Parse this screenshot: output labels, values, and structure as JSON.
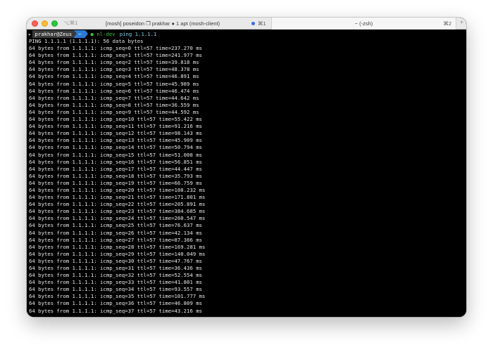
{
  "titlebar": {
    "shortcut": "⌥⌘1",
    "tabs": [
      {
        "title": "[mosh] poseidon ❐ prakhar ● 1 apt (mosh-client)",
        "shortcut": "⌘1"
      },
      {
        "title": "~ (-zsh)",
        "shortcut": "⌘2"
      }
    ],
    "new_tab": "+"
  },
  "prompt": {
    "chevron": "▸",
    "user": "prakhar@Zeus",
    "dir": "~",
    "branch": "● nl-dev",
    "command": "ping 1.1.1.1"
  },
  "output": {
    "header": "PING 1.1.1.1 (1.1.1.1): 56 data bytes",
    "lines": [
      "64 bytes from 1.1.1.1: icmp_seq=0 ttl=57 time=237.270 ms",
      "64 bytes from 1.1.1.1: icmp_seq=1 ttl=57 time=241.977 ms",
      "64 bytes from 1.1.1.1: icmp_seq=2 ttl=57 time=39.818 ms",
      "64 bytes from 1.1.1.1: icmp_seq=3 ttl=57 time=48.378 ms",
      "64 bytes from 1.1.1.1: icmp_seq=4 ttl=57 time=46.891 ms",
      "64 bytes from 1.1.1.1: icmp_seq=5 ttl=57 time=45.989 ms",
      "64 bytes from 1.1.1.1: icmp_seq=6 ttl=57 time=46.474 ms",
      "64 bytes from 1.1.1.1: icmp_seq=7 ttl=57 time=44.642 ms",
      "64 bytes from 1.1.1.1: icmp_seq=8 ttl=57 time=36.559 ms",
      "64 bytes from 1.1.1.1: icmp_seq=9 ttl=57 time=44.592 ms",
      "64 bytes from 1.1.1.1: icmp_seq=10 ttl=57 time=55.422 ms",
      "64 bytes from 1.1.1.1: icmp_seq=11 ttl=57 time=91.216 ms",
      "64 bytes from 1.1.1.1: icmp_seq=12 ttl=57 time=98.143 ms",
      "64 bytes from 1.1.1.1: icmp_seq=13 ttl=57 time=45.909 ms",
      "64 bytes from 1.1.1.1: icmp_seq=14 ttl=57 time=50.794 ms",
      "64 bytes from 1.1.1.1: icmp_seq=15 ttl=57 time=51.008 ms",
      "64 bytes from 1.1.1.1: icmp_seq=16 ttl=57 time=56.851 ms",
      "64 bytes from 1.1.1.1: icmp_seq=17 ttl=57 time=44.447 ms",
      "64 bytes from 1.1.1.1: icmp_seq=18 ttl=57 time=35.793 ms",
      "64 bytes from 1.1.1.1: icmp_seq=19 ttl=57 time=66.759 ms",
      "64 bytes from 1.1.1.1: icmp_seq=20 ttl=57 time=108.232 ms",
      "64 bytes from 1.1.1.1: icmp_seq=21 ttl=57 time=171.801 ms",
      "64 bytes from 1.1.1.1: icmp_seq=22 ttl=57 time=205.891 ms",
      "64 bytes from 1.1.1.1: icmp_seq=23 ttl=57 time=384.685 ms",
      "64 bytes from 1.1.1.1: icmp_seq=24 ttl=57 time=260.547 ms",
      "64 bytes from 1.1.1.1: icmp_seq=25 ttl=57 time=76.637 ms",
      "64 bytes from 1.1.1.1: icmp_seq=26 ttl=57 time=42.134 ms",
      "64 bytes from 1.1.1.1: icmp_seq=27 ttl=57 time=87.386 ms",
      "64 bytes from 1.1.1.1: icmp_seq=28 ttl=57 time=169.281 ms",
      "64 bytes from 1.1.1.1: icmp_seq=29 ttl=57 time=140.049 ms",
      "64 bytes from 1.1.1.1: icmp_seq=30 ttl=57 time=47.767 ms",
      "64 bytes from 1.1.1.1: icmp_seq=31 ttl=57 time=36.436 ms",
      "64 bytes from 1.1.1.1: icmp_seq=32 ttl=57 time=52.554 ms",
      "64 bytes from 1.1.1.1: icmp_seq=33 ttl=57 time=41.801 ms",
      "64 bytes from 1.1.1.1: icmp_seq=34 ttl=57 time=93.557 ms",
      "64 bytes from 1.1.1.1: icmp_seq=35 ttl=57 time=101.777 ms",
      "64 bytes from 1.1.1.1: icmp_seq=36 ttl=57 time=46.809 ms",
      "64 bytes from 1.1.1.1: icmp_seq=37 ttl=57 time=43.216 ms"
    ]
  },
  "colors": {
    "terminal_bg": "#000000",
    "terminal_fg": "#e8e8e8",
    "prompt_user_bg": "#3a3a3a",
    "prompt_dir_bg": "#2a7ad6",
    "branch": "#3fbf3f",
    "command": "#7cd3f0",
    "close": "#fe5f57",
    "minimize": "#febc2e",
    "maximize": "#28c840"
  }
}
